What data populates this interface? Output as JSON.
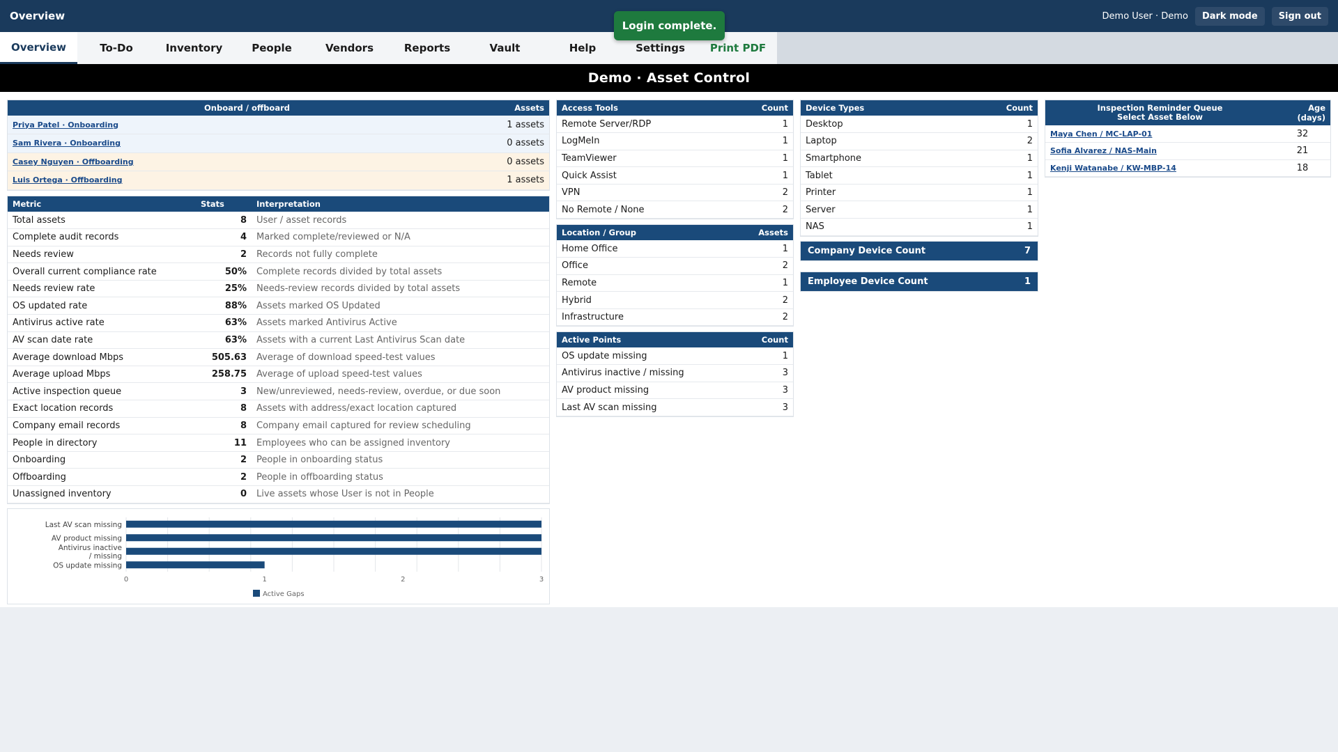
{
  "header": {
    "app_title": "Overview",
    "user": "Demo User · Demo",
    "dark_mode_label": "Dark mode",
    "sign_out_label": "Sign out"
  },
  "toast": "Login complete.",
  "tabs": [
    "Overview",
    "To-Do",
    "Inventory",
    "People",
    "Vendors",
    "Reports",
    "Vault",
    "Help",
    "Settings",
    "Print PDF"
  ],
  "banner": "Demo · Asset Control",
  "onboard": {
    "header_name": "Onboard / offboard",
    "header_assets": "Assets",
    "rows": [
      {
        "name": "Priya Patel · Onboarding",
        "assets": "1 assets",
        "kind": "onb"
      },
      {
        "name": "Sam Rivera · Onboarding",
        "assets": "0 assets",
        "kind": "onb"
      },
      {
        "name": "Casey Nguyen · Offboarding",
        "assets": "0 assets",
        "kind": "off"
      },
      {
        "name": "Luis Ortega · Offboarding",
        "assets": "1 assets",
        "kind": "off"
      }
    ]
  },
  "metrics": {
    "headers": [
      "Metric",
      "Stats",
      "Interpretation"
    ],
    "rows": [
      [
        "Total assets",
        "8",
        "User / asset records"
      ],
      [
        "Complete audit records",
        "4",
        "Marked complete/reviewed or N/A"
      ],
      [
        "Needs review",
        "2",
        "Records not fully complete"
      ],
      [
        "Overall current compliance rate",
        "50%",
        "Complete records divided by total assets"
      ],
      [
        "Needs review rate",
        "25%",
        "Needs-review records divided by total assets"
      ],
      [
        "OS updated rate",
        "88%",
        "Assets marked OS Updated"
      ],
      [
        "Antivirus active rate",
        "63%",
        "Assets marked Antivirus Active"
      ],
      [
        "AV scan date rate",
        "63%",
        "Assets with a current Last Antivirus Scan date"
      ],
      [
        "Average download Mbps",
        "505.63",
        "Average of download speed-test values"
      ],
      [
        "Average upload Mbps",
        "258.75",
        "Average of upload speed-test values"
      ],
      [
        "Active inspection queue",
        "3",
        "New/unreviewed, needs-review, overdue, or due soon"
      ],
      [
        "Exact location records",
        "8",
        "Assets with address/exact location captured"
      ],
      [
        "Company email records",
        "8",
        "Company email captured for review scheduling"
      ],
      [
        "People in directory",
        "11",
        "Employees who can be assigned inventory"
      ],
      [
        "Onboarding",
        "2",
        "People in onboarding status"
      ],
      [
        "Offboarding",
        "2",
        "People in offboarding status"
      ],
      [
        "Unassigned inventory",
        "0",
        "Live assets whose User is not in People"
      ]
    ]
  },
  "access_tools": {
    "headers": [
      "Access Tools",
      "Count"
    ],
    "rows": [
      [
        "Remote Server/RDP",
        "1"
      ],
      [
        "LogMeIn",
        "1"
      ],
      [
        "TeamViewer",
        "1"
      ],
      [
        "Quick Assist",
        "1"
      ],
      [
        "VPN",
        "2"
      ],
      [
        "No Remote / None",
        "2"
      ]
    ]
  },
  "location": {
    "headers": [
      "Location / Group",
      "Assets"
    ],
    "rows": [
      [
        "Home Office",
        "1"
      ],
      [
        "Office",
        "2"
      ],
      [
        "Remote",
        "1"
      ],
      [
        "Hybrid",
        "2"
      ],
      [
        "Infrastructure",
        "2"
      ]
    ]
  },
  "active_points": {
    "headers": [
      "Active Points",
      "Count"
    ],
    "rows": [
      [
        "OS update missing",
        "1"
      ],
      [
        "Antivirus inactive / missing",
        "3"
      ],
      [
        "AV product missing",
        "3"
      ],
      [
        "Last AV scan missing",
        "3"
      ]
    ]
  },
  "device_types": {
    "headers": [
      "Device Types",
      "Count"
    ],
    "rows": [
      [
        "Desktop",
        "1"
      ],
      [
        "Laptop",
        "2"
      ],
      [
        "Smartphone",
        "1"
      ],
      [
        "Tablet",
        "1"
      ],
      [
        "Printer",
        "1"
      ],
      [
        "Server",
        "1"
      ],
      [
        "NAS",
        "1"
      ]
    ]
  },
  "company_device": {
    "label": "Company Device Count",
    "value": "7"
  },
  "employee_device": {
    "label": "Employee Device Count",
    "value": "1"
  },
  "inspection": {
    "header_line1": "Inspection Reminder Queue",
    "header_line2": "Select Asset Below",
    "header_age": "Age (days)",
    "rows": [
      [
        "Maya Chen / MC-LAP-01",
        "32"
      ],
      [
        "Sofia Alvarez / NAS-Main",
        "21"
      ],
      [
        "Kenji Watanabe / KW-MBP-14",
        "18"
      ]
    ]
  },
  "colors": {
    "header_bg": "#1a3a5c",
    "table_header": "#1a4a7a",
    "toast_green": "#1e7a3e",
    "onboarding_row": "#eef4fb",
    "offboarding_row": "#fdf3e4"
  },
  "chart_data": {
    "type": "bar",
    "orientation": "horizontal",
    "categories": [
      "Last AV scan missing",
      "AV product missing",
      "Antivirus inactive / missing",
      "OS update missing"
    ],
    "series": [
      {
        "name": "Active Gaps",
        "values": [
          3,
          3,
          3,
          1
        ]
      }
    ],
    "xlim": [
      0,
      3
    ],
    "xticks": [
      "0",
      "1",
      "2",
      "3"
    ],
    "grid": true,
    "legend": "bottom",
    "color": "#1a4a7a"
  }
}
